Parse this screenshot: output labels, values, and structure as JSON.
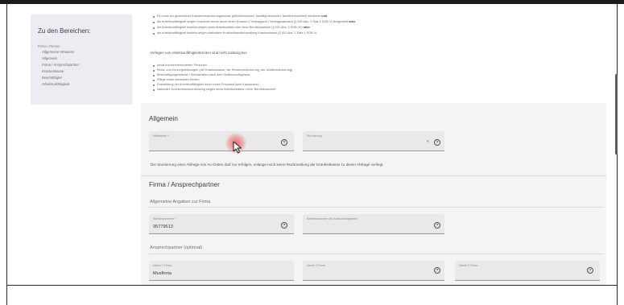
{
  "sidebar": {
    "title": "Zu den Bereichen:",
    "group": "Firma / Person",
    "items": [
      {
        "label": "Allgemeine Hinweise"
      },
      {
        "label": "Allgemein"
      },
      {
        "label": "Firma / Ansprechpartner"
      },
      {
        "label": "Krankenkasse"
      },
      {
        "label": "Beschäftigter"
      },
      {
        "label": "Arbeitsunfähigkeit"
      }
    ]
  },
  "info": {
    "lines": [
      {
        "text": "Es muss ein gesetzlicher Krankenversicherungsschutz (pflichtversichert, freiwillig versichert, familienversichert) bestehen",
        "bold": "und"
      },
      {
        "text": "die Arbeitsunfähigkeit wegen Krankheit wurde durch einen (Kassen-) Vertragsarzt / Vertragszahnarzt (§ 295 Abs. 1 Satz 1 SGB V) festgestellt",
        "bold": "oder"
      },
      {
        "text": "die Arbeitsunfähigkeit besteht wegen eines Arbeitsunfalls oder einer Berufskrankheit (§ 201 Abs. 2 SGB VII)",
        "bold": "oder"
      },
      {
        "text": "die Arbeitsunfähigkeit besteht wegen stationärer Krankenhausbehandlung Krankenkasse (§ 301 Abs. 1 Satz 1 SGB V)",
        "bold": ""
      }
    ],
    "not_allowed_heading": "Anfragen von Arbeitsunfähigkeitszeiten sind nicht zulässig bei:",
    "not_allowed": [
      "privat krankenversicherten Personen",
      "Reha- und Vorsorgeleistungen (der Krankenkasse, der Rentenversicherung, der Unfallversicherung)",
      "Beschäftigungsverbote / Schutzfristen nach dem Mutterschutzgesetz",
      "Pflege eines erkrankten Kindes",
      "Feststellung der Arbeitsunfähigkeit durch einen Privatarzt (kein Kassenarzt)",
      "stationäre Krankenhausbehandlung wegen eines Arbeitsunfalles / einer Berufskrankheit"
    ]
  },
  "allgemein": {
    "title": "Allgemein",
    "fields": {
      "mandant": {
        "label": "Mitarbeiter *",
        "value": ""
      },
      "stornierung": {
        "label": "Stornierung",
        "value": ""
      }
    },
    "note": "Die Stornierung einer Abfrage von AU-Daten darf nur erfolgen, solange noch keine Rückmeldung der Krankenkasse zu dieser Abfrage vorliegt."
  },
  "firma": {
    "title": "Firma / Ansprechpartner",
    "sub_general": "Allgemeine Angaben zur Firma",
    "fields": {
      "betriebsnummer": {
        "label": "Betriebsnummer *",
        "value": "95779613"
      },
      "betriebsnummer_abrechnung": {
        "label": "Betriebsnummer der Abrechnungsstelle",
        "value": ""
      }
    },
    "sub_contact": "Ansprechpartner (optional)",
    "contact_fields": {
      "name1": {
        "label": "Name 1 Firma",
        "value": "Musfirma"
      },
      "name2": {
        "label": "Name 2 Firma",
        "value": ""
      },
      "name3": {
        "label": "Name 3 Firma",
        "value": ""
      }
    }
  },
  "icons": {
    "help": "help-circle-icon",
    "dropdown": "dropdown-arrow-icon",
    "cursor": "mouse-cursor-icon"
  },
  "help_glyph": "?",
  "dropdown_glyph": "▾",
  "colors": {
    "sidebar_bg": "#ececf2",
    "panel_bg": "#f4f4f4",
    "field_bg": "#e9e9e9",
    "click_highlight": "#e25555"
  }
}
